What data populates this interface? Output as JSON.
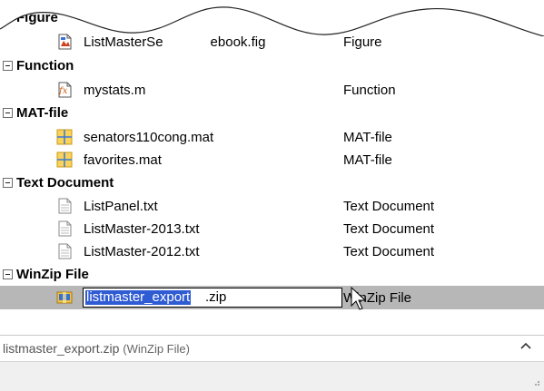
{
  "groups": [
    {
      "label": "Figure",
      "files": [
        {
          "name_left": "ListMasterSe",
          "name_right": "ebook.fig",
          "type": "Figure",
          "icon": "figure-file-icon"
        }
      ]
    },
    {
      "label": "Function",
      "files": [
        {
          "name": "mystats.m",
          "type": "Function",
          "icon": "function-file-icon"
        }
      ]
    },
    {
      "label": "MAT-file",
      "files": [
        {
          "name": "senators110cong.mat",
          "type": "MAT-file",
          "icon": "mat-file-icon"
        },
        {
          "name": "favorites.mat",
          "type": "MAT-file",
          "icon": "mat-file-icon"
        }
      ]
    },
    {
      "label": "Text Document",
      "files": [
        {
          "name": "ListPanel.txt",
          "type": "Text Document",
          "icon": "text-file-icon"
        },
        {
          "name": "ListMaster-2013.txt",
          "type": "Text Document",
          "icon": "text-file-icon"
        },
        {
          "name": "ListMaster-2012.txt",
          "type": "Text Document",
          "icon": "text-file-icon"
        }
      ]
    },
    {
      "label": "WinZip File",
      "files": [
        {
          "name_selected": "listmaster_export",
          "name_ext": ".zip",
          "type": "WinZip File",
          "icon": "zip-file-icon"
        }
      ]
    }
  ],
  "status": {
    "name": "listmaster_export.zip",
    "type": "(WinZip File)"
  },
  "colors": {
    "selection_row": "#b7b7b7",
    "text_selection": "#2f5bd3"
  }
}
